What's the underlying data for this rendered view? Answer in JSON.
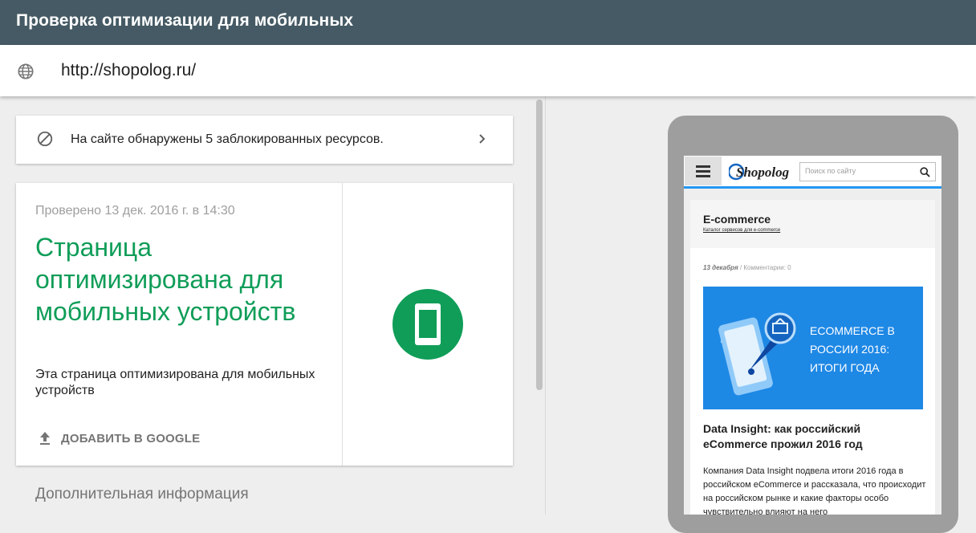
{
  "app": {
    "title": "Проверка оптимизации для мобильных"
  },
  "urlbar": {
    "url": "http://shopolog.ru/",
    "icon": "globe-icon"
  },
  "blocked_resources": {
    "text": "На сайте обнаружены 5 заблокированных ресурсов.",
    "icon": "blocked-icon",
    "chevron": "chevron-right-icon"
  },
  "result": {
    "checked": "Проверено 13 дек. 2016 г. в 14:30",
    "headline": "Страница оптимизирована для мобильных устройств",
    "description": "Эта страница оптимизирована для мобильных устройств",
    "add_button": "ДОБАВИТЬ В GOOGLE",
    "add_icon": "upload-icon",
    "badge_icon": "smartphone-icon",
    "badge_color": "#0f9d58"
  },
  "more_info": {
    "label": "Дополнительная информация"
  },
  "preview": {
    "logo": "Shopolog",
    "search_placeholder": "Поиск по сайту",
    "category": "E-commerce",
    "category_sub": "Каталог сервисов для e-commerce",
    "date": "13 декабря",
    "comments": "/ Комментарии: 0",
    "banner_text": "ECOMMERCE В РОССИИ 2016: ИТОГИ ГОДА",
    "article_title": "Data Insight: как российский eCommerce прожил 2016 год",
    "article_text": "Компания Data Insight подвела итоги 2016 года в российском eCommerce и рассказала, что происходит на российском рынке и какие факторы особо чувствительно влияют на него"
  },
  "colors": {
    "topbar": "#455a64",
    "success": "#0f9d58",
    "accent_blue": "#2196f3"
  }
}
